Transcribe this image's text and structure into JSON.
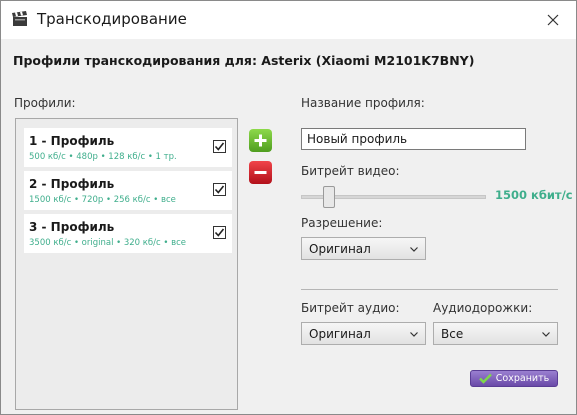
{
  "window": {
    "title": "Транскодирование",
    "app_icon": "clapperboard-icon",
    "close_icon": "close-icon"
  },
  "heading": "Профили транскодирования для: Asterix (Xiaomi M2101K7BNY)",
  "profiles": {
    "label": "Профили:",
    "items": [
      {
        "name": "1 - Профиль",
        "details": "500 кб/с • 480p • 128 кб/с • 1 тр.",
        "checked": true
      },
      {
        "name": "2 - Профиль",
        "details": "1500 кб/с • 720p • 256 кб/с • все",
        "checked": true
      },
      {
        "name": "3 - Профиль",
        "details": "3500 кб/с • original • 320 кб/с • все",
        "checked": true
      }
    ],
    "add_icon": "plus-icon",
    "remove_icon": "minus-icon"
  },
  "form": {
    "profile_name_label": "Название профиля:",
    "profile_name_value": "Новый профиль",
    "video_bitrate_label": "Битрейт видео:",
    "video_bitrate_value": "1500 кбит/с",
    "video_bitrate_slider_fraction": 0.15,
    "resolution_label": "Разрешение:",
    "resolution_value": "Оригинал",
    "audio_bitrate_label": "Битрейт аудио:",
    "audio_bitrate_value": "Оригинал",
    "audio_tracks_label": "Аудиодорожки:",
    "audio_tracks_value": "Все"
  },
  "save_button": {
    "label": "Сохранить",
    "icon": "checkmark-icon"
  },
  "colors": {
    "accent_green": "#3fae8c",
    "add_green": "#6cbf33",
    "remove_red": "#d42a2f",
    "save_purple": "#7e5fbe"
  }
}
